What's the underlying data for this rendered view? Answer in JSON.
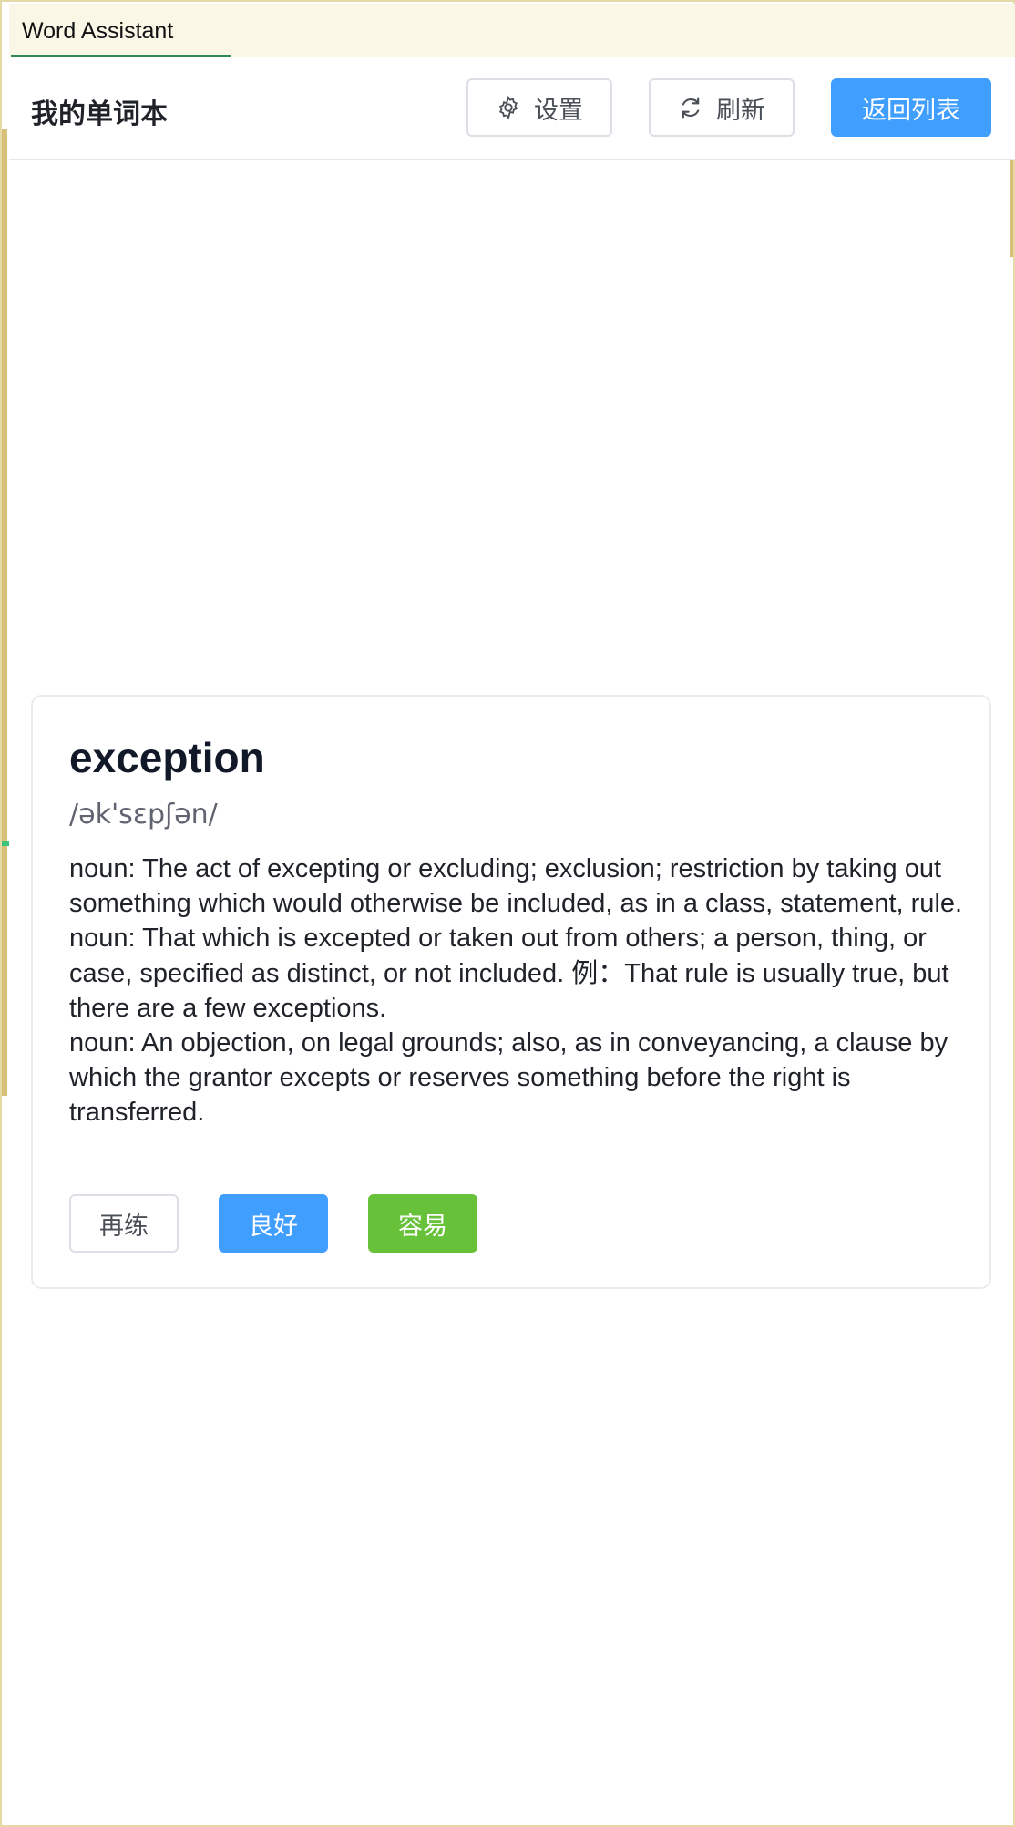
{
  "window": {
    "tab_label": "Word Assistant"
  },
  "header": {
    "title": "我的单词本",
    "settings_label": "设置",
    "refresh_label": "刷新",
    "back_label": "返回列表"
  },
  "card": {
    "word": "exception",
    "phonetic": "/ək'sɛpʃən/",
    "definitions": [
      "noun: The act of excepting or excluding; exclusion; restriction by taking out something which would otherwise be included, as in a class, statement, rule.",
      "noun: That which is excepted or taken out from others; a person, thing, or case, specified as distinct, or not included. 例：That rule is usually true, but there are a few exceptions.",
      "noun: An objection, on legal grounds; also, as in conveyancing, a clause by which the grantor excepts or reserves something before the right is transferred."
    ],
    "buttons": {
      "again": "再练",
      "good": "良好",
      "easy": "容易"
    }
  },
  "colors": {
    "primary": "#409eff",
    "success": "#67c23a",
    "tab_underline": "#2f8a55",
    "frame_accent": "#d8c079"
  },
  "icons": {
    "settings": "gear-icon",
    "refresh": "refresh-icon"
  }
}
